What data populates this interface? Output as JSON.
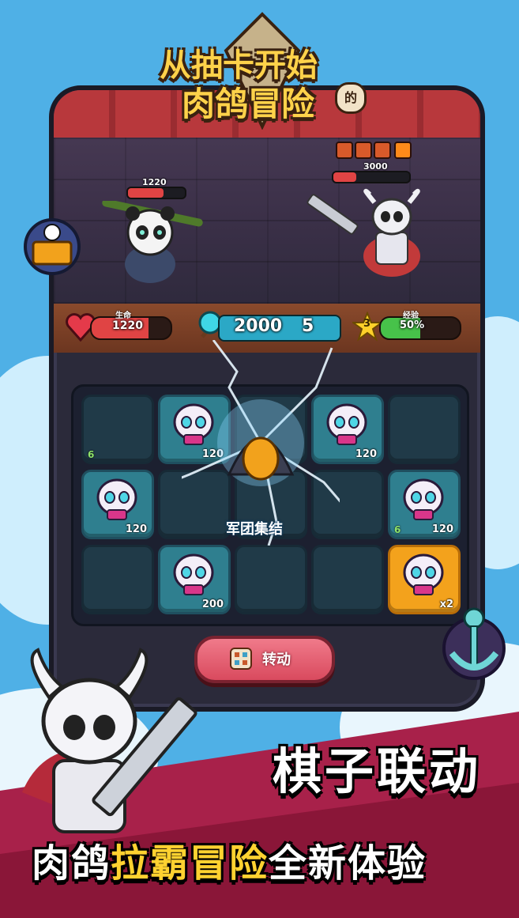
{
  "game_title": {
    "line1": "从抽卡开始",
    "line2": "肉鸽冒险",
    "suffix": "的"
  },
  "player": {
    "hp_top": "1220"
  },
  "enemy": {
    "hp_top": "3000"
  },
  "stats": {
    "hp_caption": "生命",
    "hp_value": "1220",
    "currency_value": "2000",
    "currency_overlay": "5",
    "level": "3",
    "exp_caption": "经验",
    "exp_value": "50%"
  },
  "board": {
    "cells": [
      {
        "label": "",
        "badge": "",
        "left_badge": "6",
        "style": "dark"
      },
      {
        "label": "skull",
        "badge": "120",
        "left_badge": "",
        "style": "teal"
      },
      {
        "label": "",
        "badge": "",
        "left_badge": "",
        "style": "dark"
      },
      {
        "label": "skull",
        "badge": "120",
        "left_badge": "",
        "style": "teal"
      },
      {
        "label": "",
        "badge": "",
        "left_badge": "",
        "style": "dark"
      },
      {
        "label": "skull",
        "badge": "120",
        "left_badge": "",
        "style": "teal"
      },
      {
        "label": "",
        "badge": "",
        "left_badge": "",
        "style": "dark"
      },
      {
        "label": "",
        "badge": "",
        "left_badge": "",
        "style": "dark"
      },
      {
        "label": "",
        "badge": "",
        "left_badge": "",
        "style": "dark"
      },
      {
        "label": "skull",
        "badge": "120",
        "left_badge": "6",
        "style": "teal"
      },
      {
        "label": "",
        "badge": "",
        "left_badge": "",
        "style": "dark"
      },
      {
        "label": "skull",
        "badge": "200",
        "left_badge": "",
        "style": "teal"
      },
      {
        "label": "",
        "badge": "",
        "left_badge": "",
        "style": "dark"
      },
      {
        "label": "",
        "badge": "",
        "left_badge": "",
        "style": "dark"
      },
      {
        "label": "skull",
        "badge": "x2",
        "left_badge": "",
        "style": "gold"
      }
    ],
    "center_label": "军团集结"
  },
  "spin_button": {
    "label": "转动"
  },
  "promo": {
    "line1": "棋子联动",
    "line2_a": "肉鸽",
    "line2_b": "拉霸冒险",
    "line2_c": "全新体验"
  },
  "colors": {
    "sky": "#4fb0e6",
    "hp_red": "#e04444",
    "currency_teal": "#3fd6e6",
    "exp_green": "#47c24a",
    "banner_yellow": "#ffd230"
  }
}
